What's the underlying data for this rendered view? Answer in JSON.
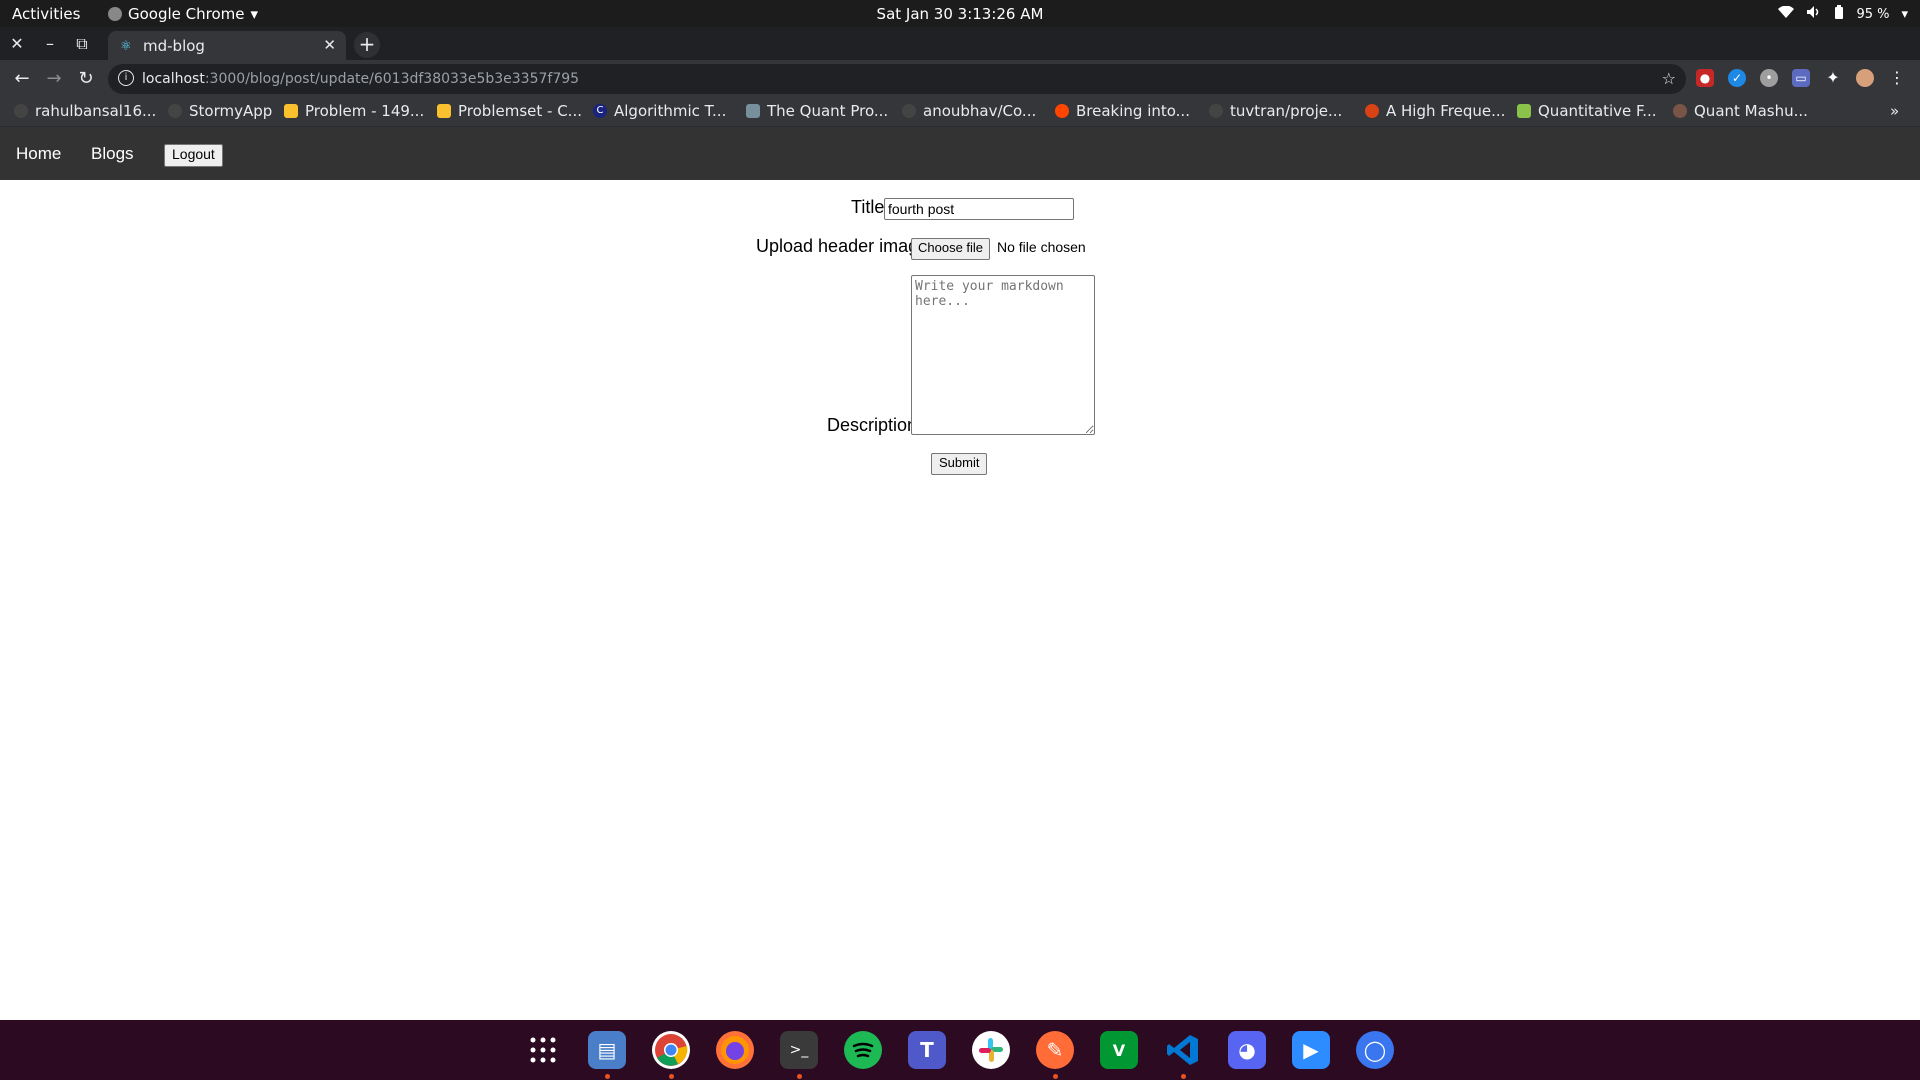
{
  "system": {
    "activities": "Activities",
    "app_name": "Google Chrome",
    "clock": "Sat Jan 30   3:13:26 AM",
    "battery": "95 %"
  },
  "browser": {
    "tab_title": "md-blog",
    "url_host": "localhost",
    "url_path": ":3000/blog/post/update/6013df38033e5b3e3357f795",
    "bookmarks": [
      "rahulbansal16...",
      "StormyApp",
      "Problem - 149...",
      "Problemset - C...",
      "Algorithmic T...",
      "The Quant Pro...",
      "anoubhav/Co...",
      "Breaking into...",
      "tuvtran/proje...",
      "A High Freque...",
      "Quantitative F...",
      "Quant Mashu..."
    ],
    "bookmark_overflow": "»"
  },
  "site_nav": {
    "home": "Home",
    "blogs": "Blogs",
    "logout": "Logout"
  },
  "form": {
    "title_label": "Title",
    "title_value": "fourth post",
    "image_label": "Upload header image",
    "choose_file": "Choose file",
    "no_file": "No file chosen",
    "description_label": "Description",
    "description_placeholder": "Write your markdown here...",
    "submit": "Submit"
  },
  "dock": {
    "apps": [
      "app-grid",
      "files",
      "chrome",
      "firefox",
      "terminal",
      "spotify",
      "teams",
      "slack",
      "postman",
      "vim",
      "vscode",
      "discord",
      "zoom",
      "signal"
    ]
  },
  "colors": {
    "nav_bg": "#333333",
    "dock_bg": "#2b0a22",
    "accent_dot": "#e95420"
  }
}
